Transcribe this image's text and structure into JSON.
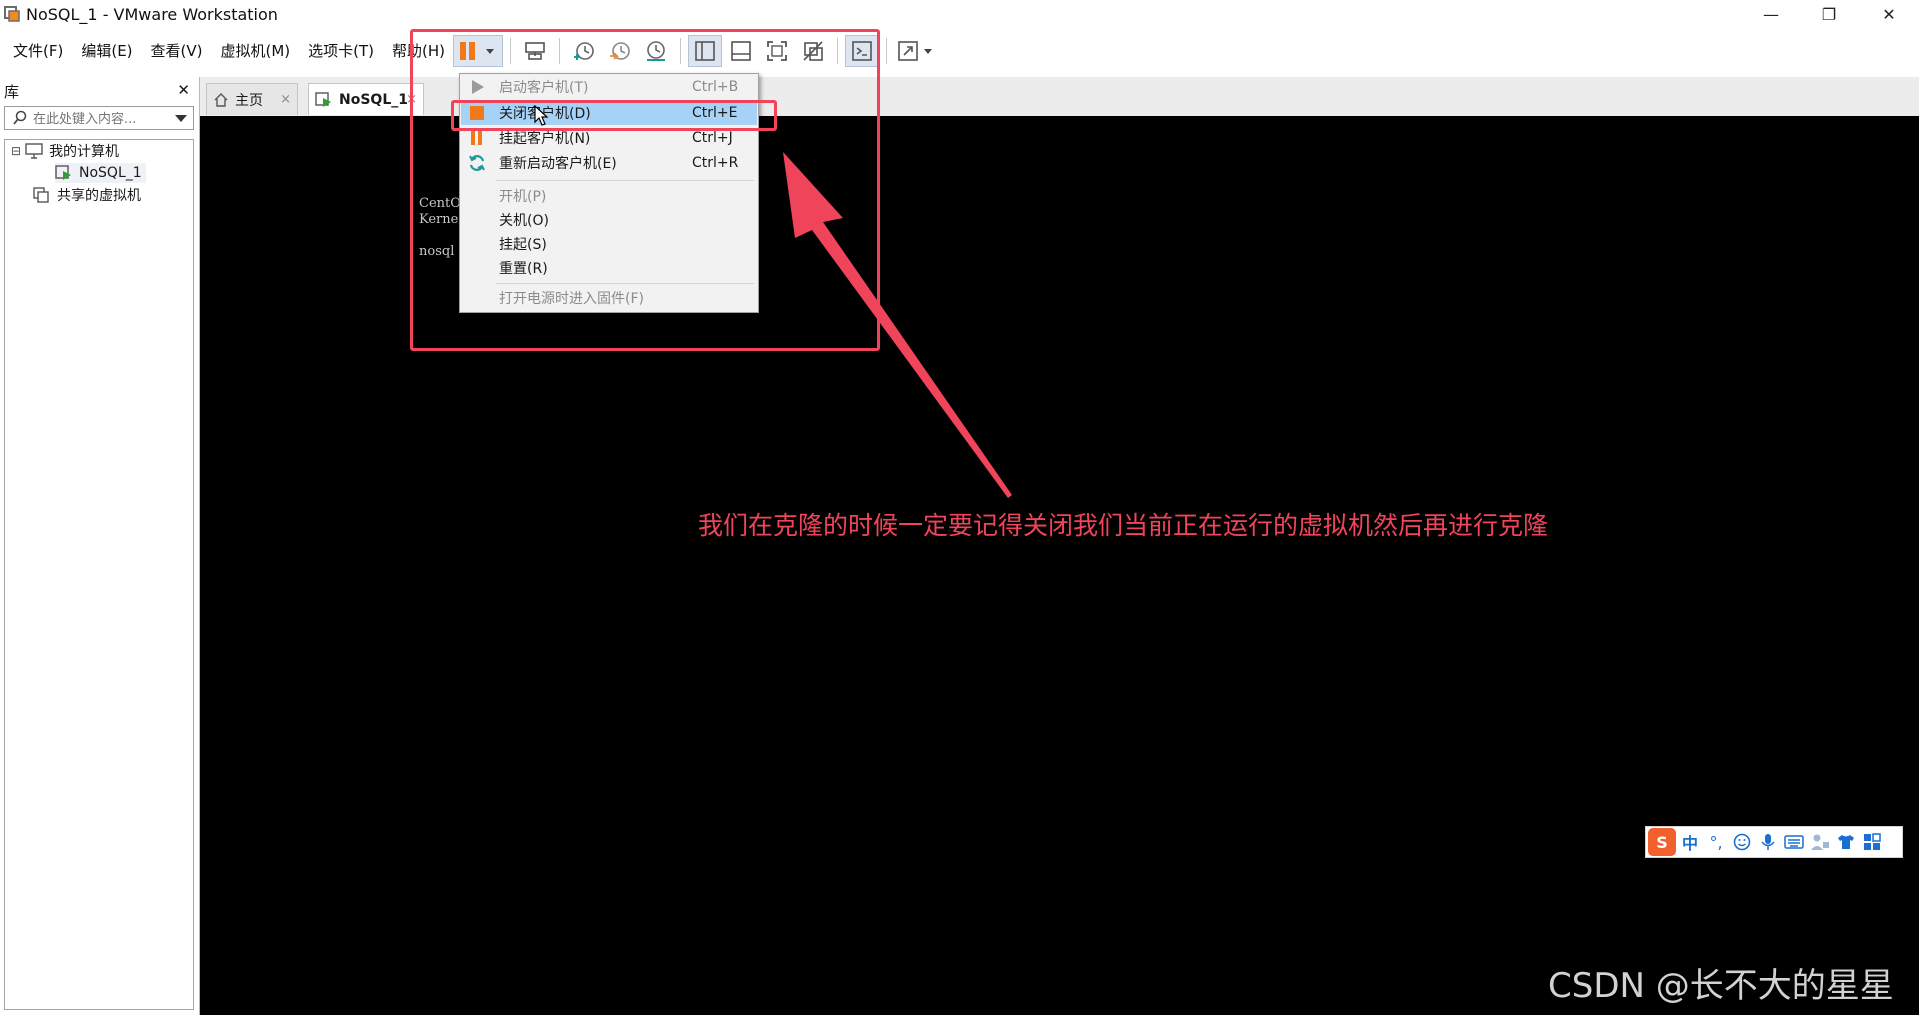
{
  "window": {
    "title": "NoSQL_1 - VMware Workstation",
    "minimize_glyph": "—",
    "restore_glyph": "❐",
    "close_glyph": "✕"
  },
  "menubar": [
    "文件(F)",
    "编辑(E)",
    "查看(V)",
    "虚拟机(M)",
    "选项卡(T)",
    "帮助(H)"
  ],
  "library": {
    "title": "库",
    "close_glyph": "✕",
    "search_placeholder": "在此处键入内容...",
    "tree": {
      "collapse_glyph": "⊟",
      "root": "我的计算机",
      "vm": "NoSQL_1",
      "shared": "共享的虚拟机"
    }
  },
  "tabs": [
    {
      "label": "主页",
      "active": false
    },
    {
      "label": "NoSQL_1",
      "active": true
    }
  ],
  "tab_close_glyph": "×",
  "power_menu": {
    "items": [
      {
        "label": "启动客户机(T)",
        "shortcut": "Ctrl+B",
        "disabled": true,
        "icon": "play-icon"
      },
      {
        "label": "关闭客户机(D)",
        "shortcut": "Ctrl+E",
        "disabled": false,
        "highlighted": true,
        "icon": "stop-icon"
      },
      {
        "label": "挂起客户机(N)",
        "shortcut": "Ctrl+J",
        "disabled": false,
        "icon": "pause-icon"
      },
      {
        "label": "重新启动客户机(E)",
        "shortcut": "Ctrl+R",
        "disabled": false,
        "icon": "restart-icon"
      },
      {
        "label": "开机(P)",
        "disabled": true
      },
      {
        "label": "关机(O)",
        "disabled": false
      },
      {
        "label": "挂起(S)",
        "disabled": false
      },
      {
        "label": "重置(R)",
        "disabled": false
      },
      {
        "label": "打开电源时进入固件(F)",
        "disabled": true
      }
    ]
  },
  "console": {
    "lines": [
      "CentO",
      "Kerne",
      "nosql"
    ]
  },
  "annotation": "我们在克隆的时候一定要记得关闭我们当前正在运行的虚拟机然后再进行克隆",
  "ime": {
    "logo": "S",
    "lang": "中",
    "punct": "°,"
  },
  "watermark": "CSDN @长不大的星星",
  "colors": {
    "accent_red": "#f0445a",
    "menu_highlight": "#a6d2f7",
    "power_orange": "#f07a1a",
    "teal": "#1a9a9a"
  }
}
